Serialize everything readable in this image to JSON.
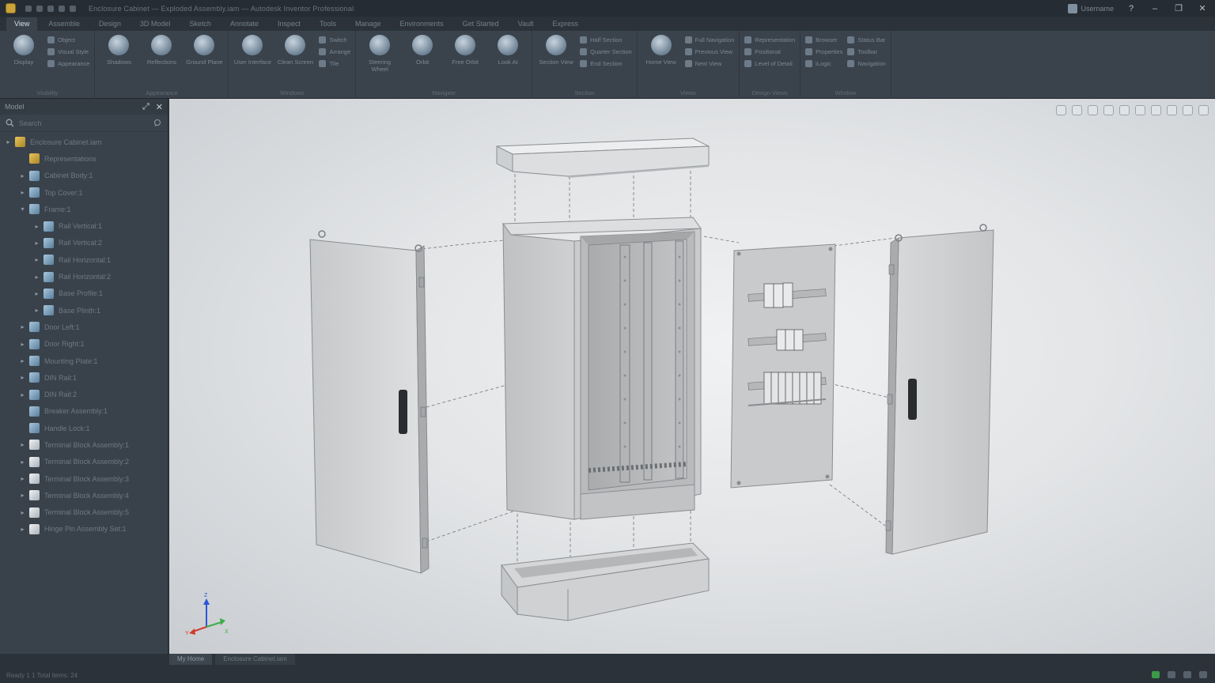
{
  "titlebar": {
    "doc_title": "Enclosure Cabinet — Exploded Assembly.iam — Autodesk Inventor Professional",
    "user_name": "Username",
    "help": "?",
    "minimize": "–",
    "maximize": "❐",
    "close": "✕"
  },
  "ribbon_tabs": [
    "View",
    "Assemble",
    "Design",
    "3D Model",
    "Sketch",
    "Annotate",
    "Inspect",
    "Tools",
    "Manage",
    "Environments",
    "Get Started",
    "Vault",
    "Express"
  ],
  "ribbon": {
    "groups": [
      {
        "name": "Visibility",
        "big": [
          {
            "label": "Display"
          }
        ],
        "small": [
          "Object",
          "Visual Style",
          "Appearance"
        ]
      },
      {
        "name": "Appearance",
        "big": [
          {
            "label": "Shadows"
          },
          {
            "label": "Reflections"
          },
          {
            "label": "Ground Plane"
          }
        ],
        "small": []
      },
      {
        "name": "Windows",
        "big": [
          {
            "label": "User Interface"
          },
          {
            "label": "Clean Screen"
          }
        ],
        "small": [
          "Switch",
          "Arrange",
          "Tile"
        ]
      },
      {
        "name": "Navigate",
        "big": [
          {
            "label": "Steering Wheel"
          },
          {
            "label": "Orbit"
          },
          {
            "label": "Free Orbit"
          },
          {
            "label": "Look At"
          }
        ],
        "small": []
      },
      {
        "name": "Section",
        "big": [
          {
            "label": "Section View"
          }
        ],
        "small": [
          "Half Section",
          "Quarter Section",
          "End Section"
        ]
      },
      {
        "name": "Views",
        "big": [
          {
            "label": "Home View"
          }
        ],
        "small": [
          "Full Navigation",
          "Previous View",
          "Next View"
        ]
      },
      {
        "name": "Design Views",
        "big": [],
        "small": [
          "Representation",
          "Positional",
          "Level of Detail"
        ]
      },
      {
        "name": "Window",
        "big": [],
        "small": [
          "Browser",
          "Properties",
          "iLogic",
          "Status Bar",
          "Toolbar",
          "Navigation"
        ]
      }
    ]
  },
  "browser": {
    "title": "Model",
    "search_placeholder": "Search",
    "items": [
      {
        "label": "Enclosure Cabinet.iam",
        "level": 0,
        "icon": "folder-icon",
        "expand": "▸"
      },
      {
        "label": "Representations",
        "level": 1,
        "icon": "folder-icon",
        "expand": ""
      },
      {
        "label": "Cabinet Body:1",
        "level": 1,
        "icon": "part-icon",
        "expand": "▸"
      },
      {
        "label": "Top Cover:1",
        "level": 1,
        "icon": "part-icon",
        "expand": "▸"
      },
      {
        "label": "Frame:1",
        "level": 1,
        "icon": "part-icon",
        "expand": "▾"
      },
      {
        "label": "Rail Vertical:1",
        "level": 2,
        "icon": "part-icon",
        "expand": "▸"
      },
      {
        "label": "Rail Vertical:2",
        "level": 2,
        "icon": "part-icon",
        "expand": "▸"
      },
      {
        "label": "Rail Horizontal:1",
        "level": 2,
        "icon": "part-icon",
        "expand": "▸"
      },
      {
        "label": "Rail Horizontal:2",
        "level": 2,
        "icon": "part-icon",
        "expand": "▸"
      },
      {
        "label": "Base Profile:1",
        "level": 2,
        "icon": "part-icon",
        "expand": "▸"
      },
      {
        "label": "Base Plinth:1",
        "level": 2,
        "icon": "part-icon",
        "expand": "▸"
      },
      {
        "label": "Door Left:1",
        "level": 1,
        "icon": "part-icon",
        "expand": "▸"
      },
      {
        "label": "Door Right:1",
        "level": 1,
        "icon": "part-icon",
        "expand": "▸"
      },
      {
        "label": "Mounting Plate:1",
        "level": 1,
        "icon": "part-icon",
        "expand": "▸"
      },
      {
        "label": "DIN Rail:1",
        "level": 1,
        "icon": "part-icon",
        "expand": "▸"
      },
      {
        "label": "DIN Rail:2",
        "level": 1,
        "icon": "part-icon",
        "expand": "▸"
      },
      {
        "label": "Breaker Assembly:1",
        "level": 1,
        "icon": "part-icon",
        "expand": ""
      },
      {
        "label": "Handle Lock:1",
        "level": 1,
        "icon": "part-icon",
        "expand": ""
      },
      {
        "label": "Terminal Block Assembly:1",
        "level": 1,
        "icon": "white-part-icon",
        "expand": "▸"
      },
      {
        "label": "Terminal Block Assembly:2",
        "level": 1,
        "icon": "white-part-icon",
        "expand": "▸"
      },
      {
        "label": "Terminal Block Assembly:3",
        "level": 1,
        "icon": "white-part-icon",
        "expand": "▸"
      },
      {
        "label": "Terminal Block Assembly:4",
        "level": 1,
        "icon": "white-part-icon",
        "expand": "▸"
      },
      {
        "label": "Terminal Block Assembly:5",
        "level": 1,
        "icon": "white-part-icon",
        "expand": "▸"
      },
      {
        "label": "Hinge Pin Assembly Set:1",
        "level": 1,
        "icon": "white-part-icon",
        "expand": "▸"
      }
    ]
  },
  "viewport": {
    "triad": {
      "x": "X",
      "y": "Y",
      "z": "Z"
    },
    "accent_red": "#d23a2c",
    "accent_green": "#3fae49",
    "accent_blue": "#2d55d8"
  },
  "statusbar": {
    "doc_tabs": [
      "My Home",
      "Enclosure Cabinet.iam"
    ],
    "status_text": "Ready   1   1   Total items: 24"
  }
}
